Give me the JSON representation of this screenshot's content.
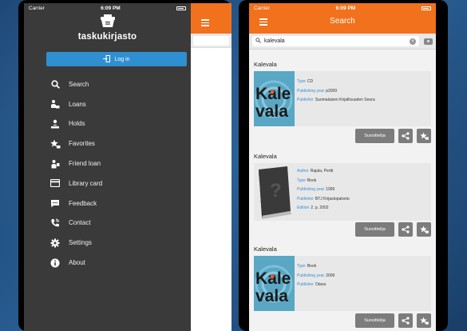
{
  "left_screen": {
    "status": {
      "carrier": "Carrier",
      "time": "6:09 PM"
    },
    "drawer": {
      "app_title": "taskukirjasto",
      "login_label": "Log in",
      "menu": [
        {
          "label": "Search",
          "icon": "search-icon"
        },
        {
          "label": "Loans",
          "icon": "loans-icon"
        },
        {
          "label": "Holds",
          "icon": "holds-icon"
        },
        {
          "label": "Favorites",
          "icon": "favorites-icon"
        },
        {
          "label": "Friend loan",
          "icon": "friend-loan-icon"
        },
        {
          "label": "Library card",
          "icon": "library-card-icon"
        },
        {
          "label": "Feedback",
          "icon": "feedback-icon"
        },
        {
          "label": "Contact",
          "icon": "contact-icon"
        },
        {
          "label": "Settings",
          "icon": "settings-icon"
        },
        {
          "label": "About",
          "icon": "about-icon"
        }
      ]
    }
  },
  "right_screen": {
    "status": {
      "carrier": "Carrier",
      "time": "6:09 PM"
    },
    "header": {
      "title": "Search"
    },
    "search": {
      "query": "kalevala"
    },
    "results": [
      {
        "title": "Kalevala",
        "cover_text": [
          "Kale",
          "vala"
        ],
        "fields": [
          {
            "label": "Type",
            "value": "CD"
          },
          {
            "label": "Publishing year",
            "value": "p2009"
          },
          {
            "label": "Publisher",
            "value": "Suomalaisen Kirjallisuuden Seura"
          }
        ],
        "recommend_label": "Suosittelija"
      },
      {
        "title": "Kalevala",
        "cover_text": [
          "?"
        ],
        "fields": [
          {
            "label": "Author",
            "value": "Rajala, Pertti"
          },
          {
            "label": "Type",
            "value": "Book"
          },
          {
            "label": "Publishing year",
            "value": "1999"
          },
          {
            "label": "Publisher",
            "value": "BTJ Kirjastopalvelu"
          },
          {
            "label": "Edition",
            "value": "2. p. 2002"
          }
        ],
        "recommend_label": "Suosittelija"
      },
      {
        "title": "Kalevala",
        "cover_text": [
          "Kale",
          "vala"
        ],
        "fields": [
          {
            "label": "Type",
            "value": "Book"
          },
          {
            "label": "Publishing year",
            "value": "2009"
          },
          {
            "label": "Publisher",
            "value": "Otava"
          }
        ],
        "recommend_label": "Suosittelija"
      }
    ]
  },
  "colors": {
    "accent": "#f2711c",
    "drawer": "#3a3a3a",
    "login": "#2f8fd1",
    "label": "#3a8fd0"
  }
}
